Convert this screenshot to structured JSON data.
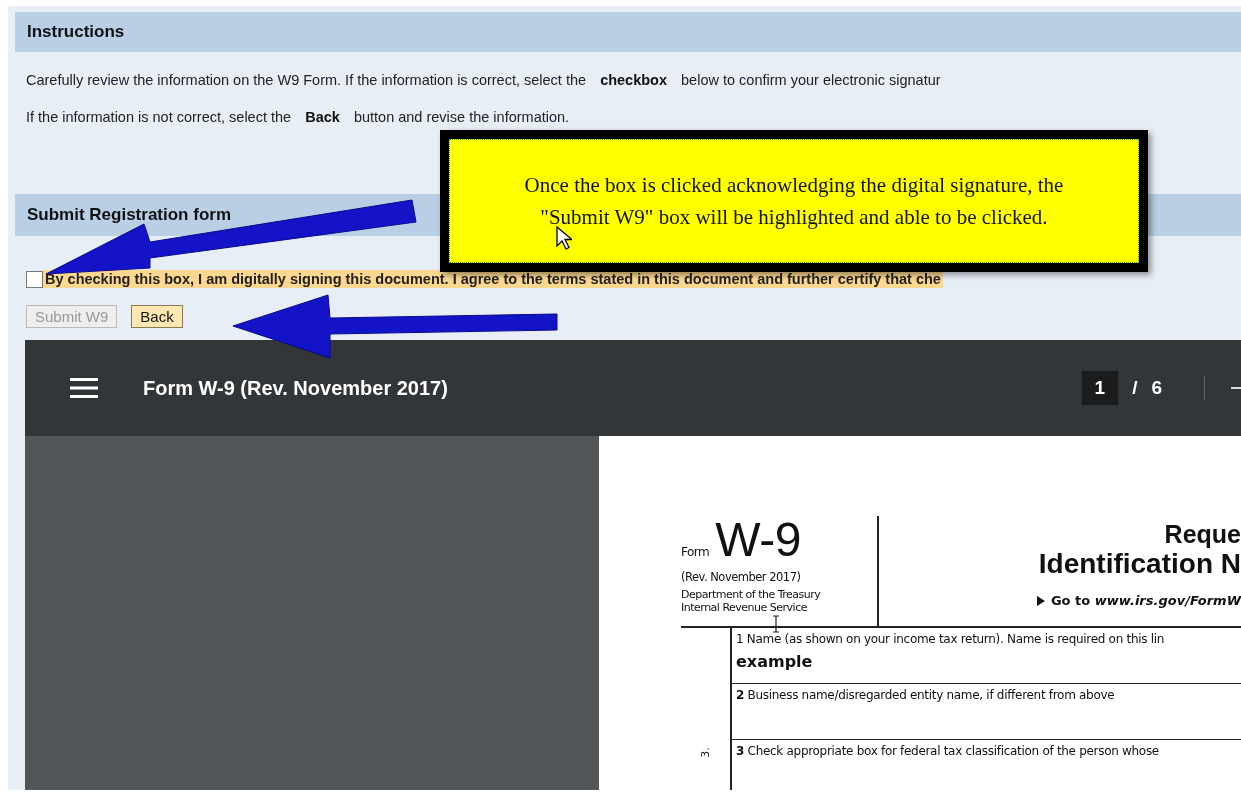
{
  "instructions": {
    "title": "Instructions",
    "lines": [
      "Carefully review the information on the W9 Form. If the information is correct, select the **checkbox** below to confirm your electronic signatur",
      "If the information is not correct, select the **Back** button and revise the information."
    ]
  },
  "submit_section": {
    "title": "Submit Registration form",
    "agreement": {
      "checked": false,
      "text": "By checking this box, I am digitally signing this document. I agree to the terms stated in this document and further certify that che"
    },
    "buttons": [
      {
        "label": "Submit W9",
        "disabled": true
      },
      {
        "label": "Back",
        "disabled": false
      }
    ]
  },
  "callout": {
    "text": "Once the box is clicked acknowledging the digital signature, the \"Submit W9\" box will be highlighted and able to be clicked."
  },
  "pdf_viewer": {
    "title": "Form W-9 (Rev. November 2017)",
    "page": "1",
    "page_separator": "/",
    "page_count": "6",
    "form": {
      "form_label": "Form",
      "form_number": "W-9",
      "revision": "(Rev. November 2017)",
      "department": "Department of the Treasury",
      "service": "Internal Revenue Service",
      "title_lines": [
        "Reque",
        "Identification N"
      ],
      "go_to": "Go to *www.irs.gov/FormW*",
      "side_label": "3.",
      "fields": [
        {
          "label": "1 Name (as shown on your income tax return). Name is required on this lin",
          "value": "example"
        },
        {
          "label": "**2** Business name/disregarded entity name, if different from above"
        },
        {
          "label": "**3** Check appropriate box for federal tax classification of the person whose"
        }
      ]
    }
  }
}
